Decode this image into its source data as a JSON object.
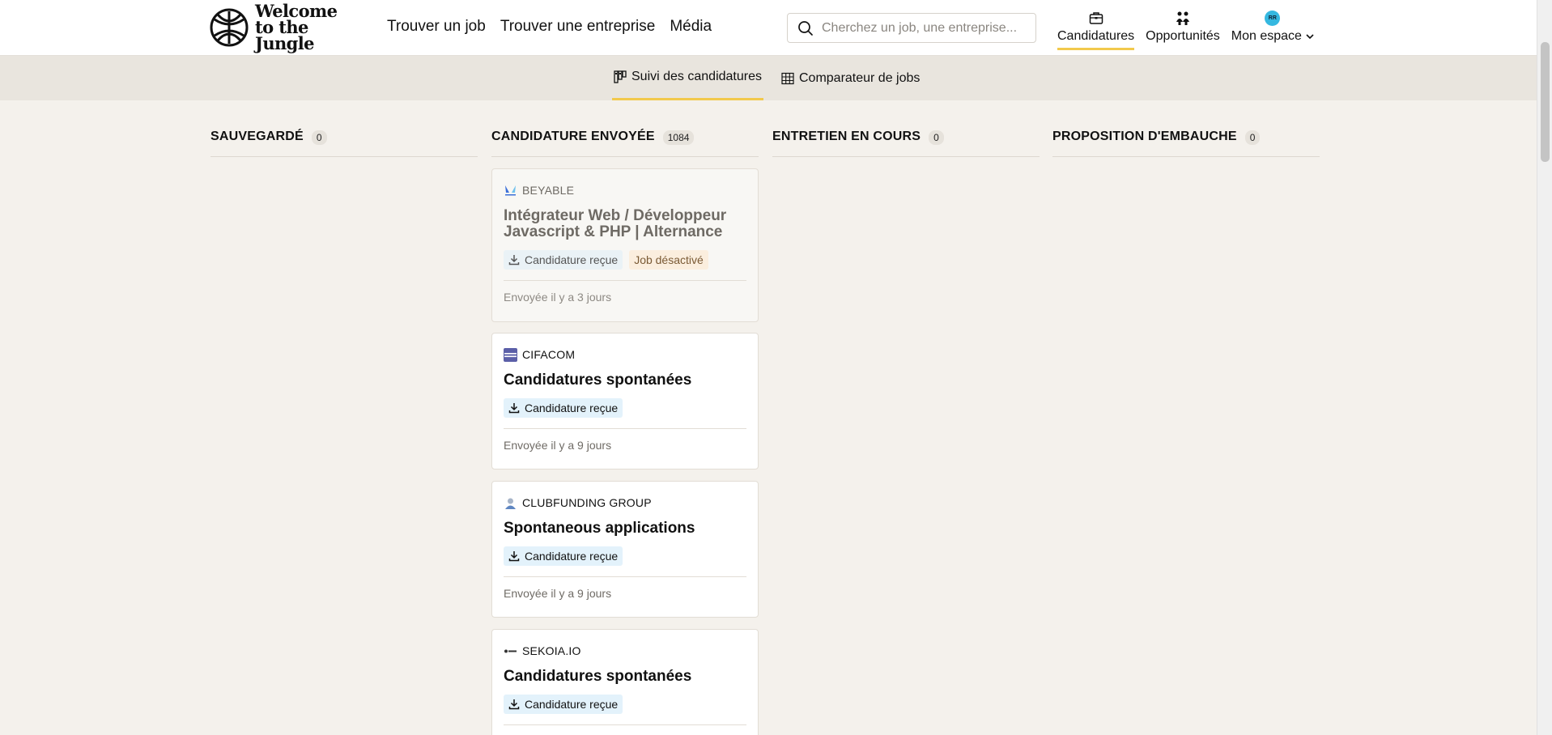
{
  "brand": {
    "name": "Welcome to the Jungle",
    "line1": "Welcome",
    "line2": "to the Jungle"
  },
  "nav": {
    "links": [
      "Trouver un job",
      "Trouver une entreprise",
      "Média"
    ],
    "search_placeholder": "Cherchez un job, une entreprise...",
    "right": [
      {
        "label": "Candidatures",
        "icon": "briefcase-icon",
        "active": true
      },
      {
        "label": "Opportunités",
        "icon": "people-icon",
        "active": false
      },
      {
        "label": "Mon espace",
        "icon": "avatar",
        "avatar_initials": "RR",
        "active": false
      }
    ]
  },
  "subnav": {
    "tabs": [
      {
        "label": "Suivi des candidatures",
        "icon": "kanban-icon",
        "active": true
      },
      {
        "label": "Comparateur de jobs",
        "icon": "grid-icon",
        "active": false
      }
    ]
  },
  "columns": [
    {
      "title": "Sauvegardé",
      "count": "0"
    },
    {
      "title": "Candidature envoyée",
      "count": "1084"
    },
    {
      "title": "Entretien en cours",
      "count": "0"
    },
    {
      "title": "Proposition d'embauche",
      "count": "0"
    }
  ],
  "cards": [
    {
      "company": "BEYABLE",
      "title": "Intégrateur Web / Développeur Javascript & PHP | Alternance",
      "status": "Candidature reçue",
      "extra_tag": "Job désactivé",
      "sent": "Envoyée il y a 3 jours",
      "disabled": true
    },
    {
      "company": "CIFACOM",
      "title": "Candidatures spontanées",
      "status": "Candidature reçue",
      "sent": "Envoyée il y a 9 jours",
      "disabled": false
    },
    {
      "company": "CLUBFUNDING GROUP",
      "title": "Spontaneous applications",
      "status": "Candidature reçue",
      "sent": "Envoyée il y a 9 jours",
      "disabled": false
    },
    {
      "company": "SEKOIA.IO",
      "title": "Candidatures spontanées",
      "status": "Candidature reçue",
      "sent": "",
      "disabled": false
    }
  ],
  "colors": {
    "accent": "#f2c94c",
    "tag_blue": "#e3f2fb",
    "tag_warn": "#fbeede",
    "avatar": "#35b8e0"
  }
}
